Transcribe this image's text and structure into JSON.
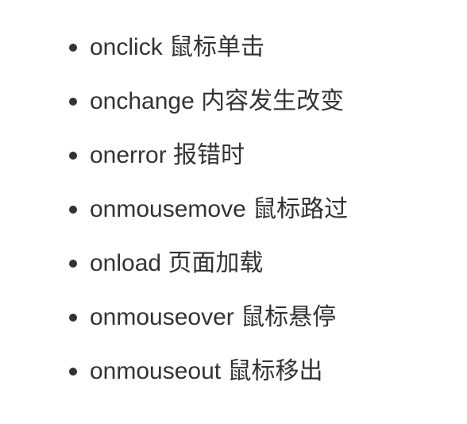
{
  "events": [
    {
      "text": "onclick 鼠标单击"
    },
    {
      "text": "onchange 内容发生改变"
    },
    {
      "text": "onerror 报错时"
    },
    {
      "text": "onmousemove 鼠标路过"
    },
    {
      "text": "onload 页面加载"
    },
    {
      "text": "onmouseover 鼠标悬停"
    },
    {
      "text": "onmouseout 鼠标移出"
    }
  ],
  "colors": {
    "text": "#333333",
    "bullet": "#333333",
    "background": "#ffffff"
  }
}
